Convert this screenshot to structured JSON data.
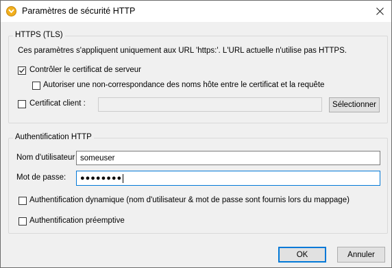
{
  "window": {
    "title": "Paramètres de sécurité HTTP"
  },
  "https_group": {
    "title": "HTTPS (TLS)",
    "info": "Ces paramètres s'appliquent uniquement aux URL 'https:'. L'URL actuelle n'utilise pas HTTPS.",
    "check_server_cert": {
      "label": "Contrôler le certificat de serveur",
      "checked": true
    },
    "allow_mismatch": {
      "label": "Autoriser une non-correspondance des noms hôte entre le certificat et la requête",
      "checked": false
    },
    "client_cert": {
      "label": "Certificat client :",
      "checked": false,
      "value": ""
    },
    "select_button": "Sélectionner"
  },
  "auth_group": {
    "title": "Authentification HTTP",
    "username_label": "Nom d'utilisateur :",
    "username_value": "someuser",
    "password_label": "Mot de passe:",
    "password_mask": "●●●●●●●●",
    "dynamic_auth": {
      "label": "Authentification dynamique (nom d'utilisateur & mot de passe sont fournis lors du mappage)",
      "checked": false
    },
    "preemptive_auth": {
      "label": "Authentification préemptive",
      "checked": false
    }
  },
  "footer": {
    "ok_label": "OK",
    "cancel_label": "Annuler"
  }
}
